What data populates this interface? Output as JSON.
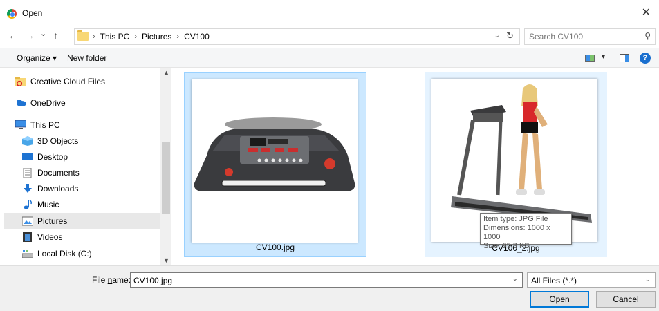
{
  "window": {
    "title": "Open"
  },
  "nav": {
    "back": "←",
    "forward": "→",
    "recent": "⌄",
    "up": "↑",
    "crumbs": [
      "This PC",
      "Pictures",
      "CV100"
    ],
    "crumb_sep": "›",
    "dropdown": "⌄",
    "refresh": "↻"
  },
  "search": {
    "placeholder": "Search CV100"
  },
  "toolbar": {
    "organize": "Organize ▾",
    "new_folder": "New folder",
    "view_dropdown": "▾",
    "help": "?"
  },
  "sidebar": {
    "items": [
      {
        "label": "Creative Cloud Files",
        "icon": "creative-cloud-icon"
      },
      {
        "label": "OneDrive",
        "icon": "onedrive-icon"
      },
      {
        "label": "This PC",
        "icon": "this-pc-icon"
      },
      {
        "label": "3D Objects",
        "icon": "3d-objects-icon"
      },
      {
        "label": "Desktop",
        "icon": "desktop-icon"
      },
      {
        "label": "Documents",
        "icon": "documents-icon"
      },
      {
        "label": "Downloads",
        "icon": "downloads-icon"
      },
      {
        "label": "Music",
        "icon": "music-icon"
      },
      {
        "label": "Pictures",
        "icon": "pictures-icon"
      },
      {
        "label": "Videos",
        "icon": "videos-icon"
      },
      {
        "label": "Local Disk (C:)",
        "icon": "local-disk-icon"
      }
    ]
  },
  "files": [
    {
      "name": "CV100.jpg",
      "state": "selected"
    },
    {
      "name": "CV100_2.jpg",
      "state": "hover"
    }
  ],
  "tooltip": {
    "type": "Item type: JPG File",
    "dimensions": "Dimensions: 1000 x 1000",
    "size": "Size: 95.3 KB"
  },
  "footer": {
    "filename_label_pre": "File ",
    "filename_label_u": "n",
    "filename_label_post": "ame:",
    "filename_value": "CV100.jpg",
    "filetype": "All Files (*.*)",
    "open_u": "O",
    "open_rest": "pen",
    "cancel": "Cancel"
  },
  "colors": {
    "selection": "#cce8ff",
    "hover": "#e5f3ff",
    "accent": "#0078d7"
  }
}
